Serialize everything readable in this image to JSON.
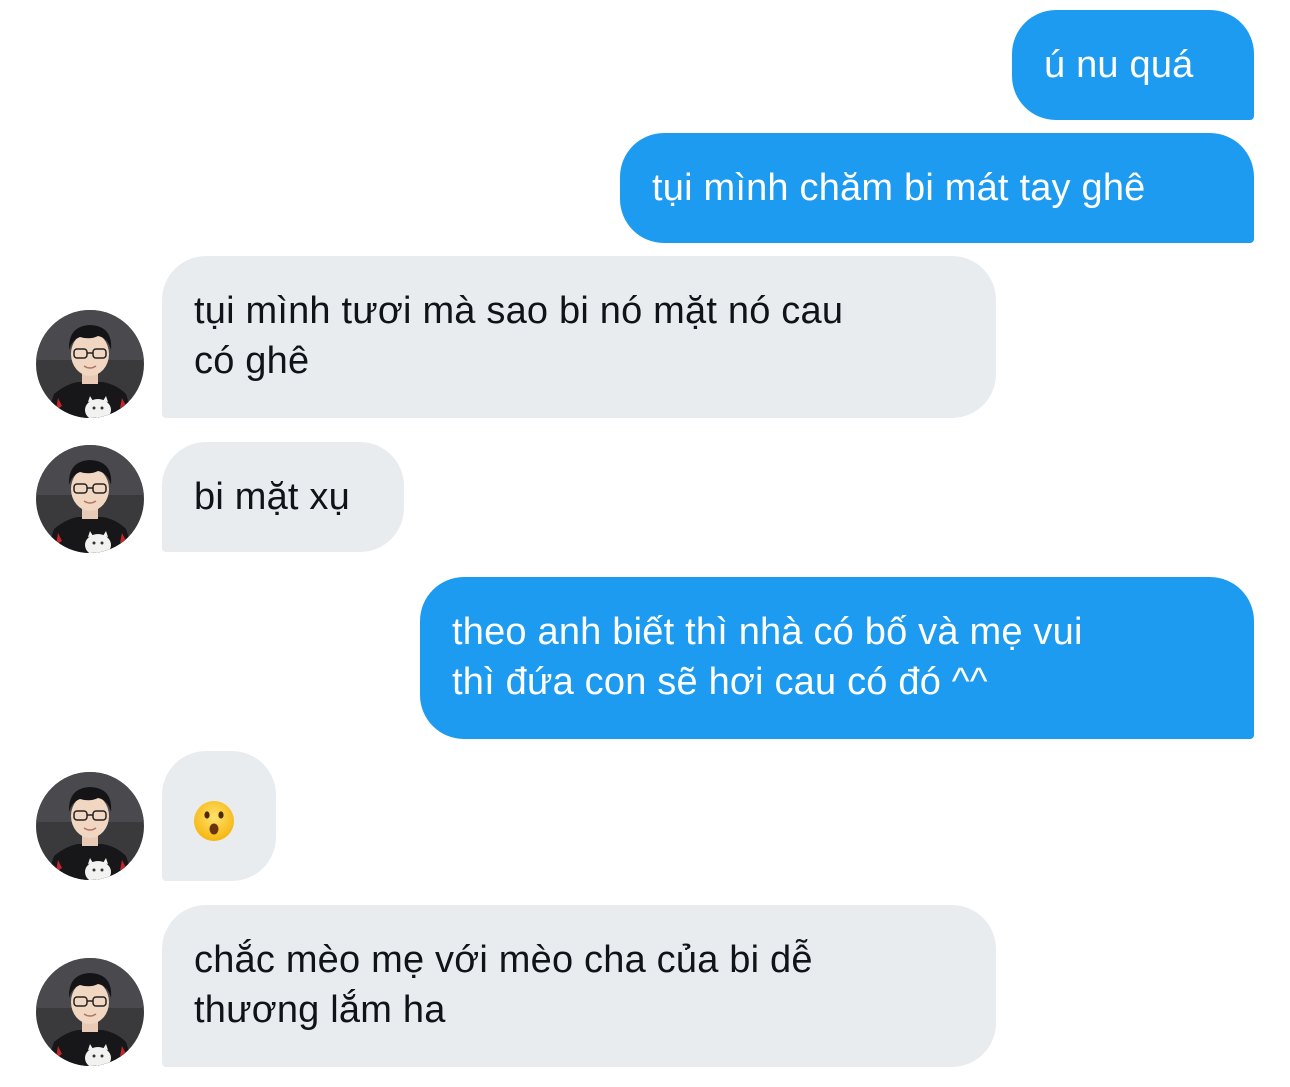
{
  "messages": [
    {
      "id": 1,
      "direction": "outgoing",
      "text": "ú nu quá"
    },
    {
      "id": 2,
      "direction": "outgoing",
      "text": "tụi mình chăm bi mát tay ghê"
    },
    {
      "id": 3,
      "direction": "incoming",
      "text": "tụi mình tươi mà sao bi nó mặt nó cau\ncó ghê"
    },
    {
      "id": 4,
      "direction": "incoming",
      "text": "bi mặt xụ"
    },
    {
      "id": 5,
      "direction": "outgoing",
      "text": "theo anh biết thì nhà có bố và mẹ vui\nthì đứa con sẽ hơi cau có đó ^^"
    },
    {
      "id": 6,
      "direction": "incoming",
      "emoji": "hushed-face-emoji"
    },
    {
      "id": 7,
      "direction": "incoming",
      "text": "chắc mèo mẹ với mèo cha của bi dễ\nthương lắm ha"
    }
  ],
  "colors": {
    "outgoing_bubble": "#1d9bf0",
    "incoming_bubble": "#e9ecef",
    "incoming_text": "#0f1419",
    "outgoing_text": "#ffffff"
  },
  "icons": {
    "avatar": "contact-avatar-photo"
  }
}
